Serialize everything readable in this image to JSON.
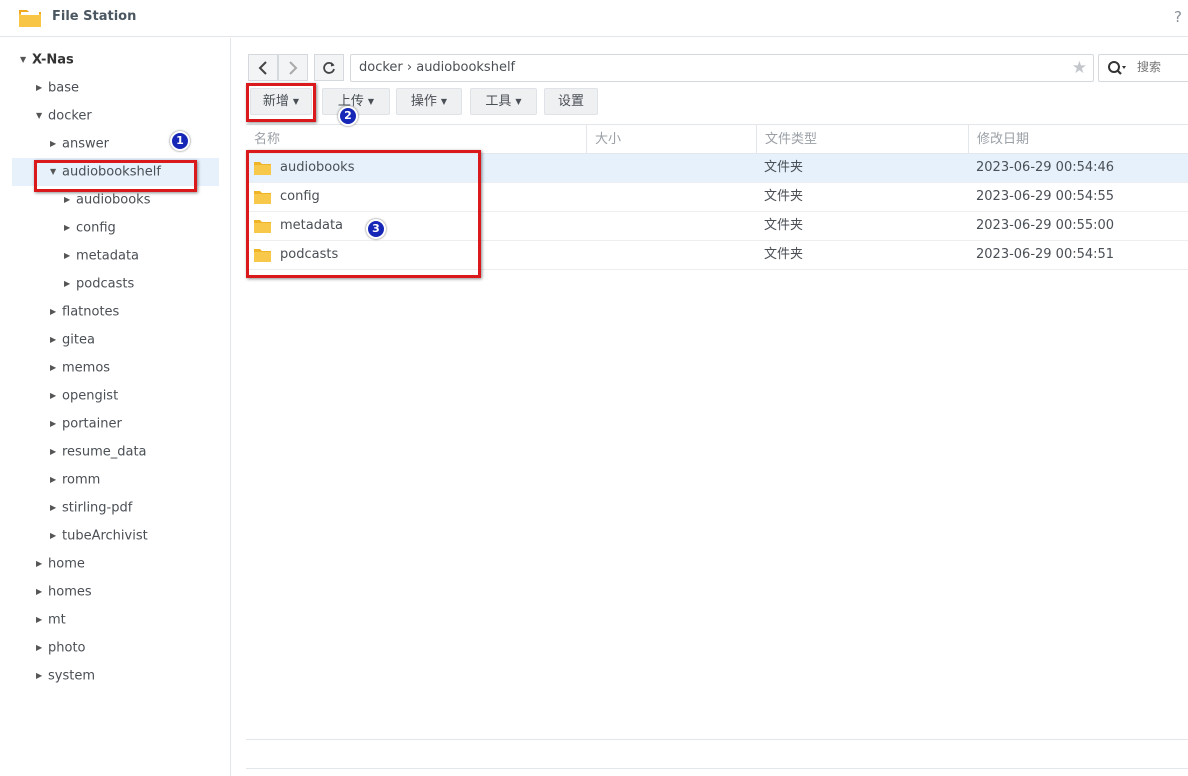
{
  "app": {
    "title": "File Station",
    "help": "?"
  },
  "sidebar": {
    "root": "X-Nas",
    "items": [
      {
        "label": "base"
      },
      {
        "label": "docker"
      },
      {
        "label": "answer"
      },
      {
        "label": "audiobookshelf"
      },
      {
        "label": "audiobooks"
      },
      {
        "label": "config"
      },
      {
        "label": "metadata"
      },
      {
        "label": "podcasts"
      },
      {
        "label": "flatnotes"
      },
      {
        "label": "gitea"
      },
      {
        "label": "memos"
      },
      {
        "label": "opengist"
      },
      {
        "label": "portainer"
      },
      {
        "label": "resume_data"
      },
      {
        "label": "romm"
      },
      {
        "label": "stirling-pdf"
      },
      {
        "label": "tubeArchivist"
      },
      {
        "label": "home"
      },
      {
        "label": "homes"
      },
      {
        "label": "mt"
      },
      {
        "label": "photo"
      },
      {
        "label": "system"
      }
    ]
  },
  "toolbar": {
    "back": "‹",
    "forward": "›",
    "refresh": "↻",
    "path": "docker › audiobookshelf",
    "search_placeholder": "搜索",
    "buttons": {
      "create": "新增",
      "upload": "上传",
      "action": "操作",
      "tools": "工具",
      "settings": "设置"
    }
  },
  "list": {
    "columns": {
      "name": "名称",
      "size": "大小",
      "type": "文件类型",
      "modified": "修改日期"
    },
    "rows": [
      {
        "name": "audiobooks",
        "size": "",
        "type": "文件夹",
        "modified": "2023-06-29 00:54:46"
      },
      {
        "name": "config",
        "size": "",
        "type": "文件夹",
        "modified": "2023-06-29 00:54:55"
      },
      {
        "name": "metadata",
        "size": "",
        "type": "文件夹",
        "modified": "2023-06-29 00:55:00"
      },
      {
        "name": "podcasts",
        "size": "",
        "type": "文件夹",
        "modified": "2023-06-29 00:54:51"
      }
    ]
  },
  "annotations": {
    "badge1": "1",
    "badge2": "2",
    "badge3": "3"
  },
  "colors": {
    "highlight": "#d9191c",
    "badge": "#1627b8",
    "selected_row": "#e6f1fb",
    "folder": "#f6c23e"
  }
}
